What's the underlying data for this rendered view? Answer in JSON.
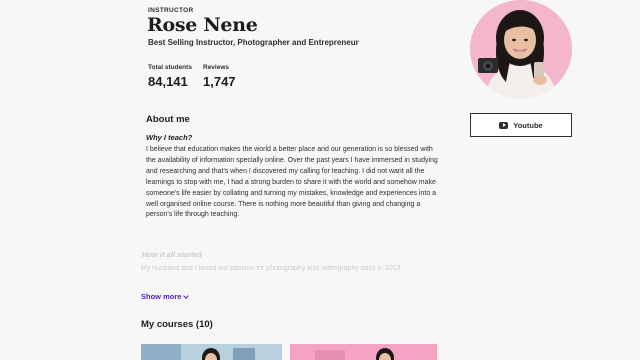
{
  "profile": {
    "role_label": "INSTRUCTOR",
    "name": "Rose Nene",
    "tagline": "Best Selling Instructor, Photographer and Entrepreneur",
    "stats": {
      "students_label": "Total students",
      "students_value": "84,141",
      "reviews_label": "Reviews",
      "reviews_value": "1,747"
    }
  },
  "social": {
    "youtube_label": "Youtube",
    "youtube_icon": "youtube-icon"
  },
  "about": {
    "heading": "About me",
    "why_heading": "Why I teach?",
    "bio": "I believe that education makes the world a better place and our generation is so blessed with the availability of information specially online. Over the past years I have immersed in studying and researching and that's when I discovered my calling for teaching. I did not want all the learnings to stop with me, I had a strong burden to share it with the world and somehow make someone's life easier by collating and turning my mistakes, knowledge and experiences into a well organised online course. There is nothing more beautiful than giving and changing a person's life through teaching.",
    "how_heading": "How it all started",
    "how_text": "My husband and I found our passion for photography and videography back in 2013.",
    "show_more_label": "Show more"
  },
  "courses": {
    "heading": "My courses (10)"
  },
  "colors": {
    "accent": "#5022c3",
    "avatar_bg": "#f4b6cd",
    "card_pink": "#f5a3c4"
  }
}
